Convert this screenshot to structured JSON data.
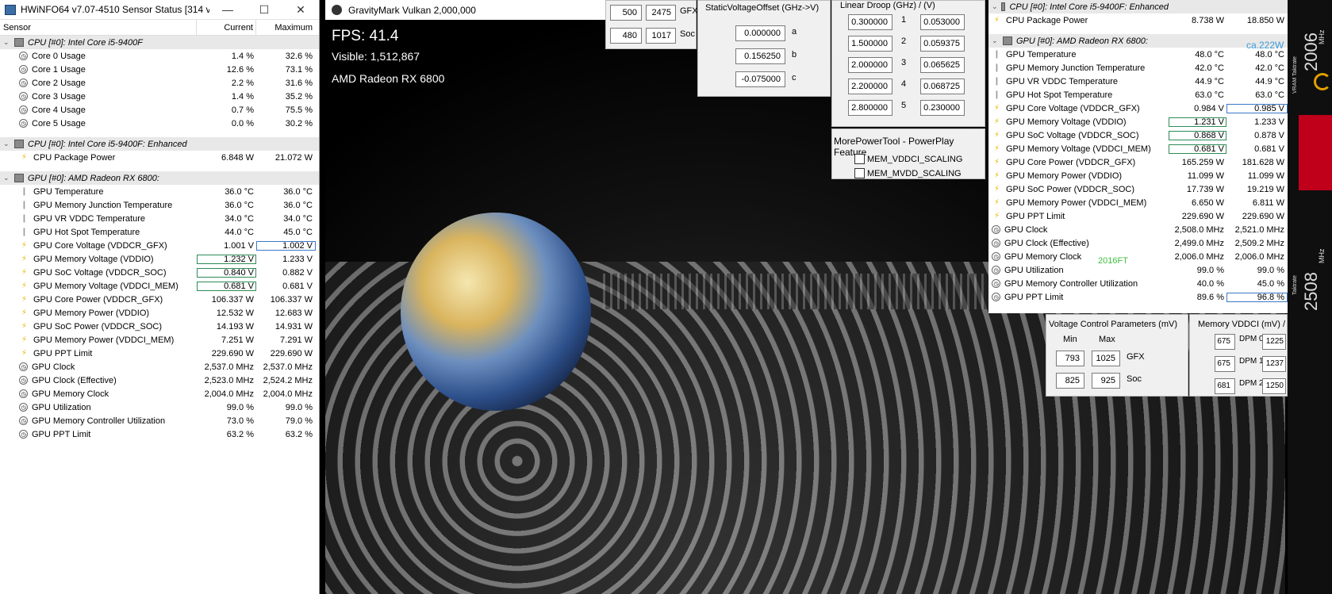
{
  "hwinfo": {
    "title": "HWiNFO64 v7.07-4510 Sensor Status [314 val...",
    "min": "—",
    "max": "☐",
    "close": "✕",
    "columns": {
      "sensor": "Sensor",
      "current": "Current",
      "maximum": "Maximum"
    },
    "rows": [
      {
        "t": "grp",
        "name": "CPU [#0]: Intel Core i5-9400F"
      },
      {
        "t": "clock",
        "name": "Core 0 Usage",
        "cur": "1.4 %",
        "max": "32.6 %"
      },
      {
        "t": "clock",
        "name": "Core 1 Usage",
        "cur": "12.6 %",
        "max": "73.1 %"
      },
      {
        "t": "clock",
        "name": "Core 2 Usage",
        "cur": "2.2 %",
        "max": "31.6 %"
      },
      {
        "t": "clock",
        "name": "Core 3 Usage",
        "cur": "1.4 %",
        "max": "35.2 %"
      },
      {
        "t": "clock",
        "name": "Core 4 Usage",
        "cur": "0.7 %",
        "max": "75.5 %"
      },
      {
        "t": "clock",
        "name": "Core 5 Usage",
        "cur": "0.0 %",
        "max": "30.2 %"
      },
      {
        "t": "gap"
      },
      {
        "t": "grp",
        "name": "CPU [#0]: Intel Core i5-9400F: Enhanced"
      },
      {
        "t": "bolt",
        "name": "CPU Package Power",
        "cur": "6.848 W",
        "max": "21.072 W"
      },
      {
        "t": "gap"
      },
      {
        "t": "grp",
        "name": "GPU [#0]: AMD Radeon RX 6800:"
      },
      {
        "t": "therm",
        "name": "GPU Temperature",
        "cur": "36.0 °C",
        "max": "36.0 °C"
      },
      {
        "t": "therm",
        "name": "GPU Memory Junction Temperature",
        "cur": "36.0 °C",
        "max": "36.0 °C"
      },
      {
        "t": "therm",
        "name": "GPU VR VDDC Temperature",
        "cur": "34.0 °C",
        "max": "34.0 °C"
      },
      {
        "t": "therm",
        "name": "GPU Hot Spot Temperature",
        "cur": "44.0 °C",
        "max": "45.0 °C"
      },
      {
        "t": "bolt",
        "name": "GPU Core Voltage (VDDCR_GFX)",
        "cur": "1.001 V",
        "max": "1.002 V",
        "mb": 1
      },
      {
        "t": "bolt",
        "name": "GPU Memory Voltage (VDDIO)",
        "cur": "1.232 V",
        "max": "1.233 V",
        "cb": 1
      },
      {
        "t": "bolt",
        "name": "GPU SoC Voltage (VDDCR_SOC)",
        "cur": "0.840 V",
        "max": "0.882 V",
        "cb": 1
      },
      {
        "t": "bolt",
        "name": "GPU Memory Voltage (VDDCI_MEM)",
        "cur": "0.681 V",
        "max": "0.681 V",
        "cb": 1
      },
      {
        "t": "bolt",
        "name": "GPU Core Power (VDDCR_GFX)",
        "cur": "106.337 W",
        "max": "106.337 W"
      },
      {
        "t": "bolt",
        "name": "GPU Memory Power (VDDIO)",
        "cur": "12.532 W",
        "max": "12.683 W"
      },
      {
        "t": "bolt",
        "name": "GPU SoC Power (VDDCR_SOC)",
        "cur": "14.193 W",
        "max": "14.931 W"
      },
      {
        "t": "bolt",
        "name": "GPU Memory Power (VDDCI_MEM)",
        "cur": "7.251 W",
        "max": "7.291 W"
      },
      {
        "t": "bolt",
        "name": "GPU PPT Limit",
        "cur": "229.690 W",
        "max": "229.690 W"
      },
      {
        "t": "clock",
        "name": "GPU Clock",
        "cur": "2,537.0 MHz",
        "max": "2,537.0 MHz"
      },
      {
        "t": "clock",
        "name": "GPU Clock (Effective)",
        "cur": "2,523.0 MHz",
        "max": "2,524.2 MHz"
      },
      {
        "t": "clock",
        "name": "GPU Memory Clock",
        "cur": "2,004.0 MHz",
        "max": "2,004.0 MHz"
      },
      {
        "t": "clock",
        "name": "GPU Utilization",
        "cur": "99.0 %",
        "max": "99.0 %"
      },
      {
        "t": "clock",
        "name": "GPU Memory Controller Utilization",
        "cur": "73.0 %",
        "max": "79.0 %"
      },
      {
        "t": "clock",
        "name": "GPU PPT Limit",
        "cur": "63.2 %",
        "max": "63.2 %"
      }
    ]
  },
  "game": {
    "title": "GravityMark Vulkan 2,000,000",
    "fps": "FPS: 41.4",
    "visible": "Visible: 1,512,867",
    "gpu": "AMD Radeon RX 6800"
  },
  "mpt": {
    "gfx": {
      "a": "500",
      "b": "2475",
      "label": "GFX"
    },
    "soc": {
      "a": "480",
      "b": "1017",
      "label": "Soc"
    },
    "svo": {
      "title": "StaticVoltageOffset (GHz->V)",
      "a": "0.000000",
      "b": "0.156250",
      "c": "-0.075000",
      "la": "a",
      "lb": "b",
      "lc": "c"
    },
    "droop": {
      "title": "Linear Droop (GHz) / (V)",
      "rows": [
        {
          "g": "0.300000",
          "n": "1",
          "v": "0.053000"
        },
        {
          "g": "1.500000",
          "n": "2",
          "v": "0.059375"
        },
        {
          "g": "2.000000",
          "n": "3",
          "v": "0.065625"
        },
        {
          "g": "2.200000",
          "n": "4",
          "v": "0.068725"
        },
        {
          "g": "2.800000",
          "n": "5",
          "v": "0.230000"
        }
      ]
    },
    "pp": {
      "title": "MorePowerTool - PowerPlay Feature",
      "f1": "MEM_VDDCI_SCALING",
      "f2": "MEM_MVDD_SCALING"
    },
    "vcp": {
      "title": "Voltage Control Parameters (mV)",
      "min": "Min",
      "max": "Max",
      "gfx_min": "793",
      "gfx_max": "1025",
      "gfx": "GFX",
      "soc_min": "825",
      "soc_max": "925",
      "soc": "Soc"
    },
    "mem": {
      "title": "Memory VDDCI (mV) / MVDD (mV)",
      "rows": [
        {
          "a": "675",
          "l": "DPM 0",
          "b": "1225"
        },
        {
          "a": "675",
          "l": "DPM 1",
          "b": "1237"
        },
        {
          "a": "681",
          "l": "DPM 2",
          "b": "1250"
        }
      ]
    }
  },
  "hw2": {
    "note": "ca.222W",
    "clocknote": "2016FT",
    "rows": [
      {
        "t": "grp",
        "name": "CPU [#0]: Intel Core i5-9400F: Enhanced"
      },
      {
        "t": "bolt",
        "name": "CPU Package Power",
        "cur": "8.738 W",
        "max": "18.850 W"
      },
      {
        "t": "gap"
      },
      {
        "t": "grp",
        "name": "GPU [#0]: AMD Radeon RX 6800:"
      },
      {
        "t": "therm",
        "name": "GPU Temperature",
        "cur": "48.0 °C",
        "max": "48.0 °C"
      },
      {
        "t": "therm",
        "name": "GPU Memory Junction Temperature",
        "cur": "42.0 °C",
        "max": "42.0 °C"
      },
      {
        "t": "therm",
        "name": "GPU VR VDDC Temperature",
        "cur": "44.9 °C",
        "max": "44.9 °C"
      },
      {
        "t": "therm",
        "name": "GPU Hot Spot Temperature",
        "cur": "63.0 °C",
        "max": "63.0 °C"
      },
      {
        "t": "bolt",
        "name": "GPU Core Voltage (VDDCR_GFX)",
        "cur": "0.984 V",
        "max": "0.985 V",
        "mb": 1
      },
      {
        "t": "bolt",
        "name": "GPU Memory Voltage (VDDIO)",
        "cur": "1.231 V",
        "max": "1.233 V",
        "cb": 1
      },
      {
        "t": "bolt",
        "name": "GPU SoC Voltage (VDDCR_SOC)",
        "cur": "0.868 V",
        "max": "0.878 V",
        "cb": 1
      },
      {
        "t": "bolt",
        "name": "GPU Memory Voltage (VDDCI_MEM)",
        "cur": "0.681 V",
        "max": "0.681 V",
        "cb": 1
      },
      {
        "t": "bolt",
        "name": "GPU Core Power (VDDCR_GFX)",
        "cur": "165.259 W",
        "max": "181.628 W"
      },
      {
        "t": "bolt",
        "name": "GPU Memory Power (VDDIO)",
        "cur": "11.099 W",
        "max": "11.099 W"
      },
      {
        "t": "bolt",
        "name": "GPU SoC Power (VDDCR_SOC)",
        "cur": "17.739 W",
        "max": "19.219 W"
      },
      {
        "t": "bolt",
        "name": "GPU Memory Power (VDDCI_MEM)",
        "cur": "6.650 W",
        "max": "6.811 W"
      },
      {
        "t": "bolt",
        "name": "GPU PPT Limit",
        "cur": "229.690 W",
        "max": "229.690 W"
      },
      {
        "t": "clock",
        "name": "GPU Clock",
        "cur": "2,508.0 MHz",
        "max": "2,521.0 MHz"
      },
      {
        "t": "clock",
        "name": "GPU Clock (Effective)",
        "cur": "2,499.0 MHz",
        "max": "2,509.2 MHz"
      },
      {
        "t": "clock",
        "name": "GPU Memory Clock",
        "cur": "2,006.0 MHz",
        "max": "2,006.0 MHz"
      },
      {
        "t": "clock",
        "name": "GPU Utilization",
        "cur": "99.0 %",
        "max": "99.0 %"
      },
      {
        "t": "clock",
        "name": "GPU Memory Controller Utilization",
        "cur": "40.0 %",
        "max": "45.0 %"
      },
      {
        "t": "clock",
        "name": "GPU PPT Limit",
        "cur": "89.6 %",
        "max": "96.8 %",
        "mb": 1
      }
    ]
  },
  "tray": {
    "v1": "2006",
    "u1": "MHz",
    "l1": "VRAM Taktrate",
    "v2": "2508",
    "u2": "MHz",
    "l2": "Taktrate",
    "accent": "#c0001a",
    "gauge": "#e0a000"
  },
  "colors": {
    "green_box": "#2e8b57",
    "blue_box": "#3a77c7",
    "note_blue": "#3a9ad9",
    "note_green": "#3fbf3f"
  }
}
